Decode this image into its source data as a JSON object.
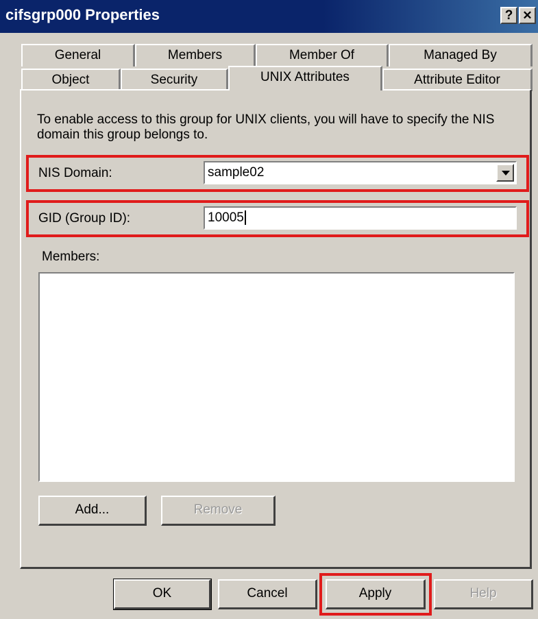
{
  "window": {
    "title": "cifsgrp000 Properties",
    "help_glyph": "?",
    "close_glyph": "✕"
  },
  "tabs": {
    "row1": [
      "General",
      "Members",
      "Member Of",
      "Managed By"
    ],
    "row2": [
      "Object",
      "Security",
      "UNIX Attributes",
      "Attribute Editor"
    ],
    "active": "UNIX Attributes"
  },
  "unix": {
    "description": "To enable access to this group for UNIX clients, you will have to specify the NIS domain this group belongs to.",
    "nis_domain_label": "NIS Domain:",
    "nis_domain_value": "sample02",
    "gid_label": "GID (Group ID):",
    "gid_value": "10005",
    "members_label": "Members:",
    "members": []
  },
  "buttons": {
    "add": "Add...",
    "remove": "Remove",
    "ok": "OK",
    "cancel": "Cancel",
    "apply": "Apply",
    "help": "Help"
  },
  "colors": {
    "highlight": "#e01b1b",
    "titlebar": "#0a246a",
    "dialog_bg": "#d4d0c8"
  },
  "icons": {
    "dropdown": "chevron-down-icon"
  }
}
